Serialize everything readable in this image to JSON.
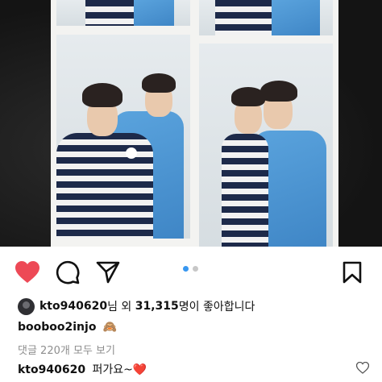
{
  "post": {
    "actions": {
      "like_icon": "heart-filled-icon",
      "comment_icon": "comment-icon",
      "share_icon": "send-icon",
      "save_icon": "bookmark-icon",
      "like_color": "#ed4956"
    },
    "carousel": {
      "total": 2,
      "active": 1,
      "active_color": "#3897f0",
      "inactive_color": "#c7c7c7"
    },
    "likes": {
      "user": "kto940620",
      "suffix_1": "님 외 ",
      "count": "31,315",
      "suffix_2": "명이 좋아합니다"
    },
    "caption": {
      "username": "booboo2injo",
      "emoji": "🙈"
    },
    "view_comments": "댓글 220개 모두 보기",
    "comment": {
      "username": "kto940620",
      "text": "퍼가요~",
      "emoji": "❤️"
    }
  }
}
